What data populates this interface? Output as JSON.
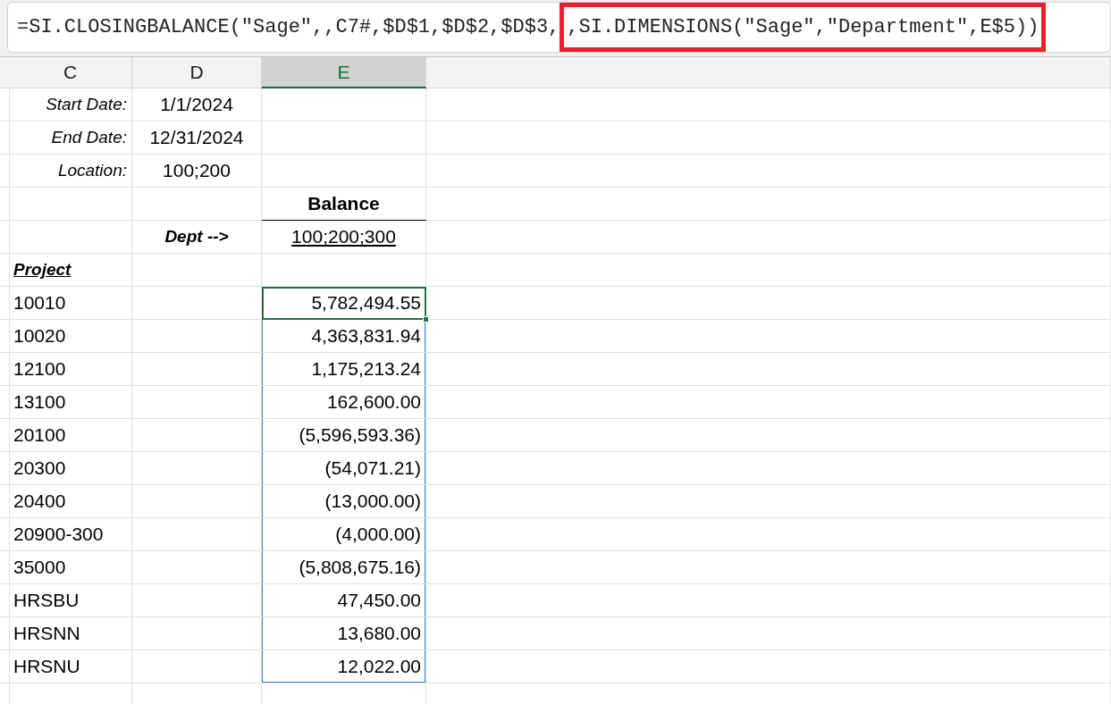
{
  "formula_bar": {
    "text": "=SI.CLOSINGBALANCE(\"Sage\",,C7#,$D$1,$D$2,$D$3,",
    "highlighted_text": ",SI.DIMENSIONS(\"Sage\",\"Department\",E$5))"
  },
  "columns": [
    {
      "label": "C",
      "selected": false
    },
    {
      "label": "D",
      "selected": false
    },
    {
      "label": "E",
      "selected": true
    }
  ],
  "parameters": [
    {
      "label": "Start Date:",
      "value": "1/1/2024"
    },
    {
      "label": "End Date:",
      "value": "12/31/2024"
    },
    {
      "label": "Location:",
      "value": "100;200"
    }
  ],
  "balance_heading": "Balance",
  "dept_label": "Dept -->",
  "dept_value": "100;200;300",
  "project_heading": "Project",
  "spill_range_outlined": true,
  "projects": [
    {
      "project": "10010",
      "balance": "5,782,494.55",
      "selected": true
    },
    {
      "project": "10020",
      "balance": "4,363,831.94",
      "selected": false
    },
    {
      "project": "12100",
      "balance": "1,175,213.24",
      "selected": false
    },
    {
      "project": "13100",
      "balance": "162,600.00",
      "selected": false
    },
    {
      "project": "20100",
      "balance": "(5,596,593.36)",
      "selected": false
    },
    {
      "project": "20300",
      "balance": "(54,071.21)",
      "selected": false
    },
    {
      "project": "20400",
      "balance": "(13,000.00)",
      "selected": false
    },
    {
      "project": "20900-300",
      "balance": "(4,000.00)",
      "selected": false
    },
    {
      "project": "35000",
      "balance": "(5,808,675.16)",
      "selected": false
    },
    {
      "project": "HRSBU",
      "balance": "47,450.00",
      "selected": false
    },
    {
      "project": "HRSNN",
      "balance": "13,680.00",
      "selected": false
    },
    {
      "project": "HRSNU",
      "balance": "12,022.00",
      "selected": false
    }
  ]
}
